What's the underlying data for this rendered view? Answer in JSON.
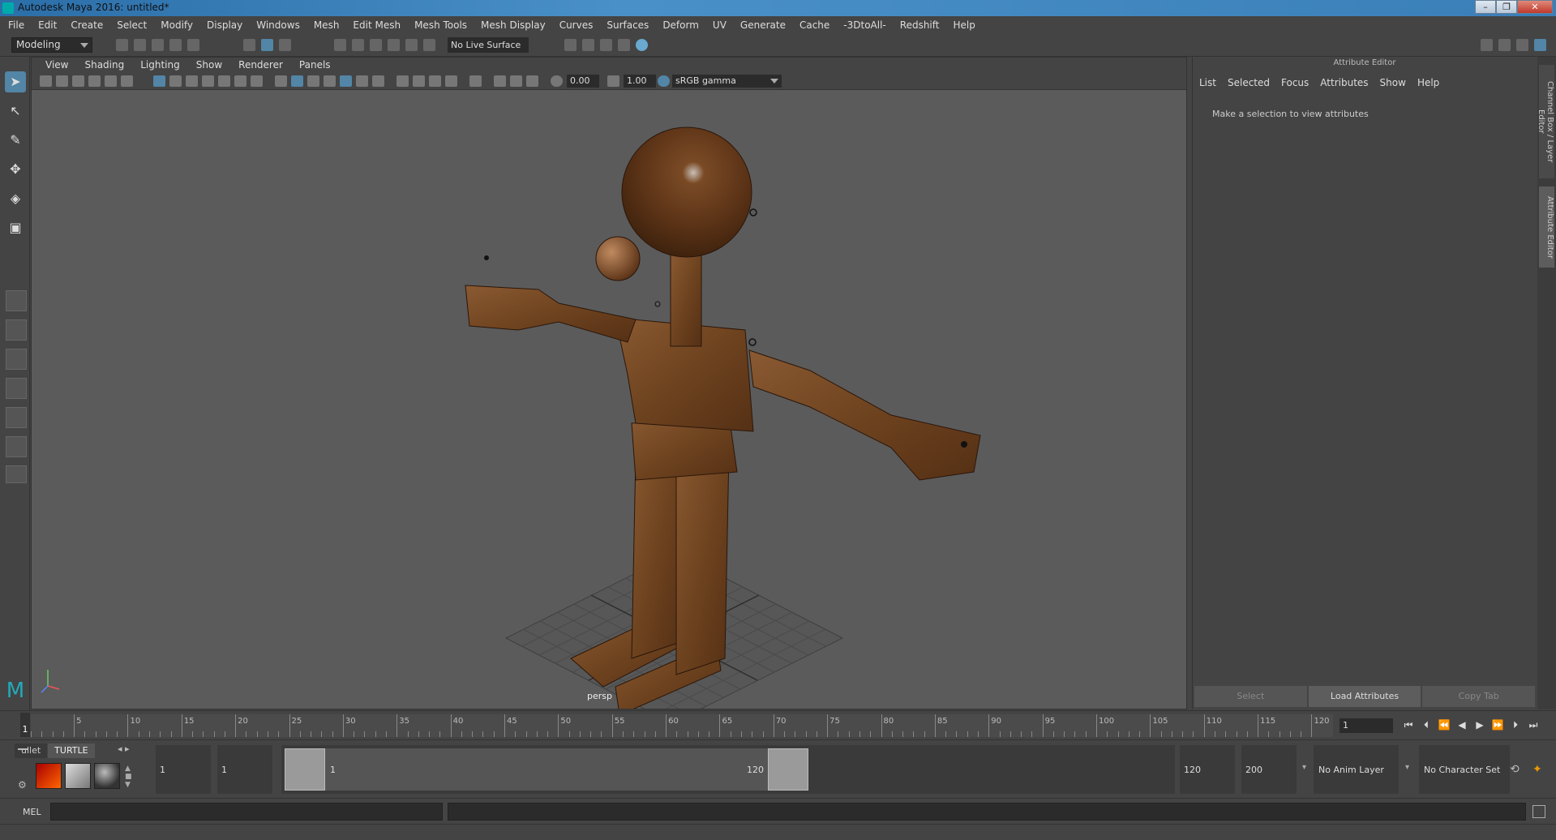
{
  "window": {
    "title": "Autodesk Maya 2016: untitled*",
    "buttons": [
      "–",
      "❐",
      "✕"
    ]
  },
  "menubar": {
    "items": [
      "File",
      "Edit",
      "Create",
      "Select",
      "Modify",
      "Display",
      "Windows",
      "Mesh",
      "Edit Mesh",
      "Mesh Tools",
      "Mesh Display",
      "Curves",
      "Surfaces",
      "Deform",
      "UV",
      "Generate",
      "Cache",
      "-3DtoAll-",
      "Redshift",
      "Help"
    ]
  },
  "statusline": {
    "mode": "Modeling",
    "live_surface": "No Live Surface"
  },
  "viewport": {
    "panel_menu": [
      "View",
      "Shading",
      "Lighting",
      "Show",
      "Renderer",
      "Panels"
    ],
    "exposure": "0.00",
    "gamma": "1.00",
    "color_space": "sRGB gamma",
    "camera": "persp"
  },
  "attribute_editor": {
    "title": "Attribute Editor",
    "menu": [
      "List",
      "Selected",
      "Focus",
      "Attributes",
      "Show",
      "Help"
    ],
    "hint": "Make a selection to view attributes",
    "buttons": {
      "select": "Select",
      "load": "Load Attributes",
      "copy": "Copy Tab"
    }
  },
  "side_tabs": {
    "channel_box": "Channel Box / Layer Editor",
    "attribute_editor": "Attribute Editor"
  },
  "timeslider": {
    "tick_labels": [
      "5",
      "10",
      "15",
      "20",
      "25",
      "30",
      "35",
      "40",
      "45",
      "50",
      "55",
      "60",
      "65",
      "70",
      "75",
      "80",
      "85",
      "90",
      "95",
      "100",
      "105",
      "110",
      "115",
      "120"
    ],
    "current_frame_marker": "1",
    "current_frame": "1"
  },
  "shelf": {
    "tabs": [
      "ullet",
      "TURTLE"
    ]
  },
  "range": {
    "start_time": "1",
    "playback_start": "1",
    "handle_start": "1",
    "handle_end": "120",
    "playback_end": "120",
    "end_time": "200",
    "anim_layer": "No Anim Layer",
    "character_set": "No Character Set"
  },
  "cmdline": {
    "label": "MEL"
  }
}
